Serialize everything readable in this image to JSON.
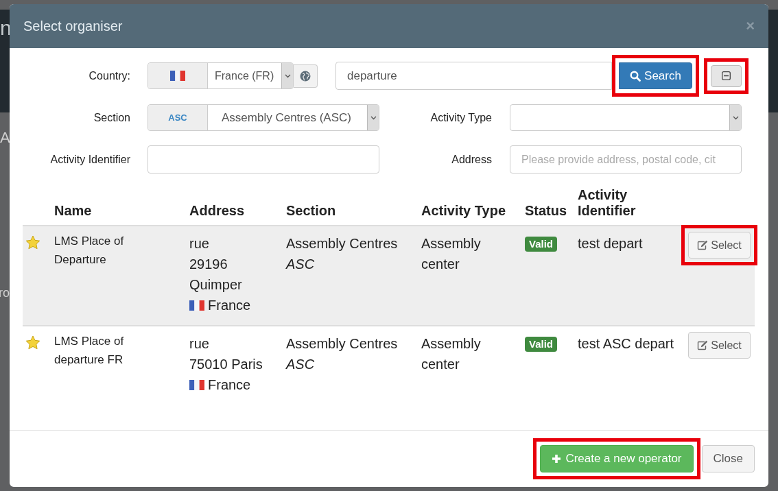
{
  "background": {
    "fragments": [
      "n",
      "A",
      "ro"
    ]
  },
  "dialog": {
    "title": "Select organiser",
    "close_icon": "×"
  },
  "form": {
    "country": {
      "label": "Country:",
      "value": "France (FR)"
    },
    "search": {
      "value": "departure"
    },
    "search_button": {
      "label": "Search",
      "highlighted": true
    },
    "collapse_button": {
      "highlighted": true
    },
    "section": {
      "label": "Section",
      "code": "ASC",
      "value": "Assembly Centres (ASC)"
    },
    "activity_type": {
      "label": "Activity Type"
    },
    "activity_identifier": {
      "label": "Activity Identifier"
    },
    "address": {
      "label": "Address",
      "placeholder": "Please provide address, postal code, cit"
    }
  },
  "table": {
    "columns": [
      "Name",
      "Address",
      "Section",
      "Activity Type",
      "Status",
      "Activity Identifier"
    ],
    "rows": [
      {
        "selected": true,
        "favorite": true,
        "name": "LMS Place of Departure",
        "address": [
          "rue",
          "29196",
          "Quimper"
        ],
        "country": "France",
        "section": "Assembly Centres",
        "section_code": "ASC",
        "activity_type": "Assembly center",
        "status": "Valid",
        "identifier": "test depart",
        "action": {
          "label": "Select",
          "highlighted": true
        }
      },
      {
        "selected": false,
        "favorite": true,
        "name": "LMS Place of departure FR",
        "address": [
          "rue",
          "75010 Paris"
        ],
        "country": "France",
        "section": "Assembly Centres",
        "section_code": "ASC",
        "activity_type": "Assembly center",
        "status": "Valid",
        "identifier": "test ASC depart",
        "action": {
          "label": "Select",
          "highlighted": false
        }
      }
    ]
  },
  "footer": {
    "create_button": {
      "label": "Create a new operator",
      "highlighted": true
    },
    "close_button": {
      "label": "Close"
    }
  }
}
